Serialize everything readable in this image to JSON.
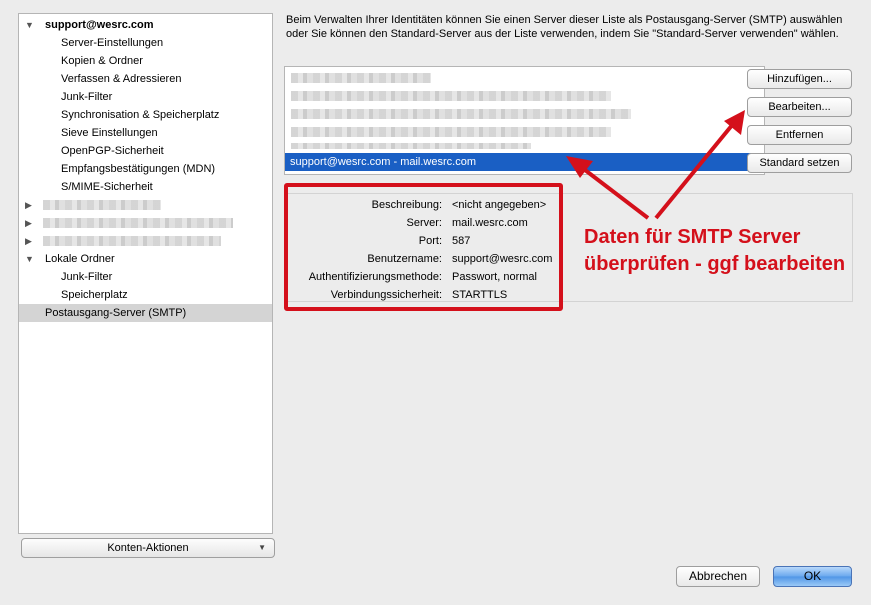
{
  "tree": {
    "items": [
      {
        "label": "support@wesrc.com",
        "indent": 0,
        "expanded": true,
        "bold": true
      },
      {
        "label": "Server-Einstellungen",
        "indent": 1
      },
      {
        "label": "Kopien & Ordner",
        "indent": 1
      },
      {
        "label": "Verfassen & Adressieren",
        "indent": 1
      },
      {
        "label": "Junk-Filter",
        "indent": 1
      },
      {
        "label": "Synchronisation & Speicherplatz",
        "indent": 1
      },
      {
        "label": "Sieve Einstellungen",
        "indent": 1
      },
      {
        "label": "OpenPGP-Sicherheit",
        "indent": 1
      },
      {
        "label": "Empfangsbestätigungen (MDN)",
        "indent": 1
      },
      {
        "label": "S/MIME-Sicherheit",
        "indent": 1
      },
      {
        "label": "",
        "indent": 0,
        "collapsed": true,
        "blurred": true
      },
      {
        "label": "",
        "indent": 0,
        "collapsed": true,
        "blurred": true
      },
      {
        "label": "",
        "indent": 0,
        "collapsed": true,
        "blurred": true
      },
      {
        "label": "Lokale Ordner",
        "indent": 0,
        "expanded": true
      },
      {
        "label": "Junk-Filter",
        "indent": 1
      },
      {
        "label": "Speicherplatz",
        "indent": 1
      },
      {
        "label": "Postausgang-Server (SMTP)",
        "indent": 0,
        "selected": true
      }
    ],
    "account_actions_label": "Konten-Aktionen"
  },
  "description": "Beim Verwalten Ihrer Identitäten können Sie einen Server dieser Liste als Postausgang-Server (SMTP) auswählen oder Sie können den Standard-Server aus der Liste verwenden, indem Sie \"Standard-Server verwenden\" wählen.",
  "server_list": {
    "selected_entry": "support@wesrc.com - mail.wesrc.com"
  },
  "buttons": {
    "add": "Hinzufügen...",
    "edit": "Bearbeiten...",
    "remove": "Entfernen",
    "set_default": "Standard setzen",
    "cancel": "Abbrechen",
    "ok": "OK"
  },
  "details": [
    {
      "label": "Beschreibung:",
      "value": "<nicht angegeben>"
    },
    {
      "label": "Server:",
      "value": "mail.wesrc.com"
    },
    {
      "label": "Port:",
      "value": "587"
    },
    {
      "label": "Benutzername:",
      "value": "support@wesrc.com"
    },
    {
      "label": "Authentifizierungsmethode:",
      "value": "Passwort, normal"
    },
    {
      "label": "Verbindungssicherheit:",
      "value": "STARTTLS"
    }
  ],
  "annotation": {
    "line1": "Daten für SMTP Server",
    "line2": "überprüfen - ggf bearbeiten",
    "color": "#d4101b"
  },
  "colors": {
    "selection": "#1a5fc4",
    "accent_red": "#d4101b"
  }
}
